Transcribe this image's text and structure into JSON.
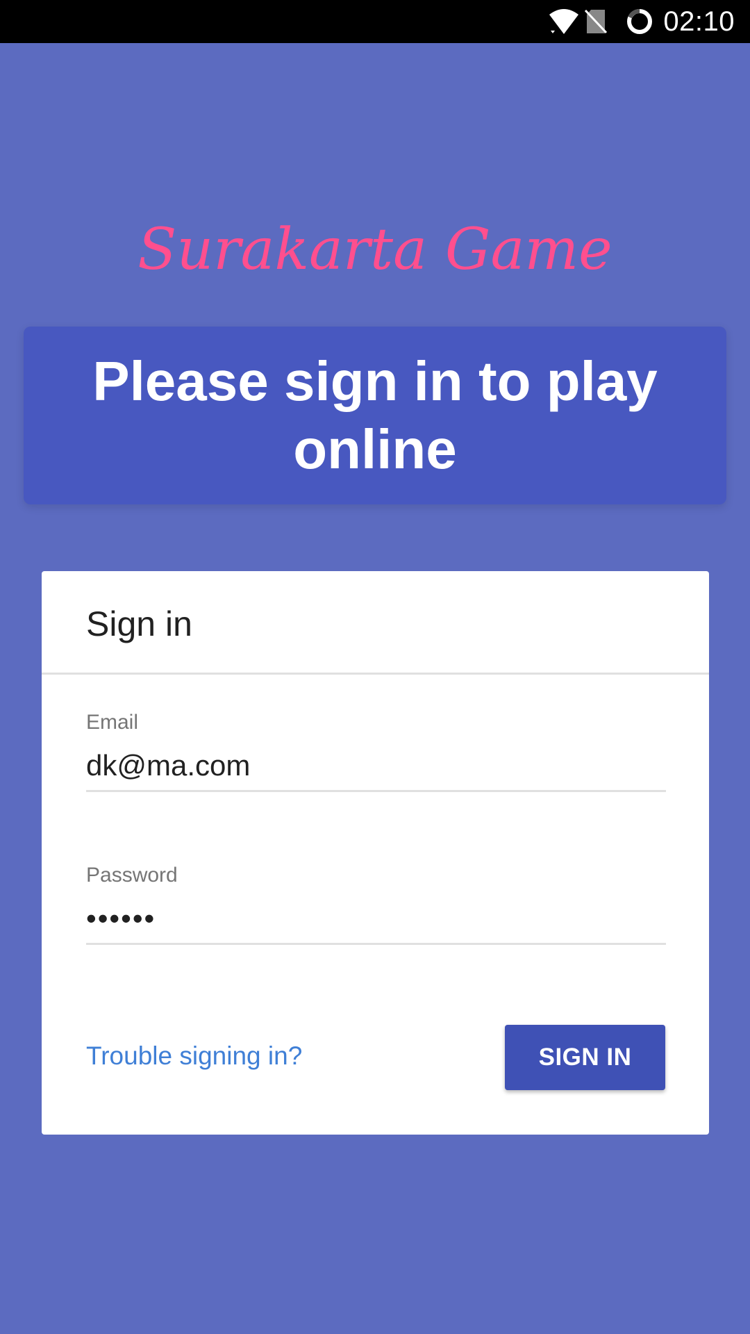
{
  "status_bar": {
    "time": "02:10",
    "icons": [
      "wifi-icon",
      "no-sim-icon",
      "battery-loading-icon"
    ]
  },
  "app": {
    "title": "Surakarta Game",
    "banner": "Please sign in to play online"
  },
  "sign_in_card": {
    "title": "Sign in",
    "email_label": "Email",
    "email_value": "dk@ma.com",
    "password_label": "Password",
    "password_value": "••••••",
    "trouble_link": "Trouble signing in?",
    "submit_label": "SIGN IN"
  },
  "colors": {
    "background": "#5c6bc0",
    "banner": "#4858c0",
    "title_accent": "#ff4f8e",
    "button": "#3f51b5",
    "link": "#3f7fd6"
  }
}
